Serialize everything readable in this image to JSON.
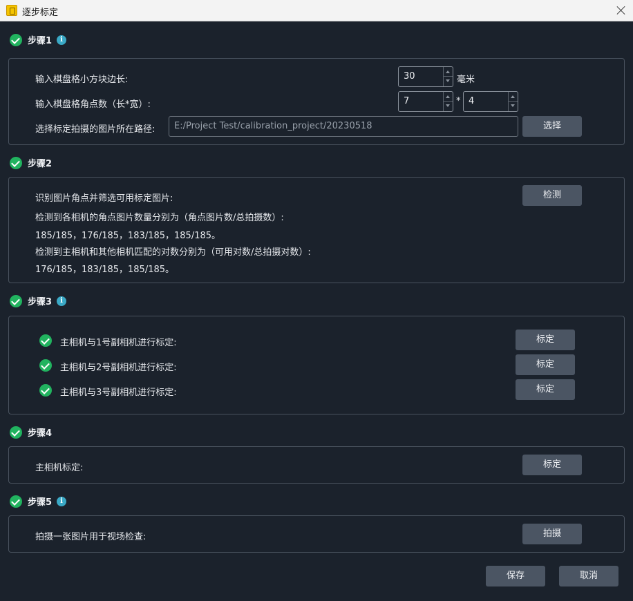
{
  "window": {
    "title": "逐步标定"
  },
  "step1": {
    "title": "步骤1",
    "square_label": "输入棋盘格小方块边长:",
    "square_value": "30",
    "square_unit": "毫米",
    "corners_label": "输入棋盘格角点数（长*宽）:",
    "corners_length": "7",
    "corners_sep": "*",
    "corners_width": "4",
    "path_label": "选择标定拍摄的图片所在路径:",
    "path_value": "E:/Project Test/calibration_project/20230518",
    "choose_button": "选择"
  },
  "step2": {
    "title": "步骤2",
    "detect_label": "识别图片角点并筛选可用标定图片:",
    "detect_button": "检测",
    "line1": "检测到各相机的角点图片数量分别为（角点图片数/总拍摄数）:",
    "line2": "185/185，176/185，183/185，185/185。",
    "line3": "检测到主相机和其他相机匹配的对数分别为（可用对数/总拍摄对数）:",
    "line4": "176/185，183/185，185/185。"
  },
  "step3": {
    "title": "步骤3",
    "items": [
      {
        "label": "主相机与1号副相机进行标定:",
        "button": "标定"
      },
      {
        "label": "主相机与2号副相机进行标定:",
        "button": "标定"
      },
      {
        "label": "主相机与3号副相机进行标定:",
        "button": "标定"
      }
    ]
  },
  "step4": {
    "title": "步骤4",
    "label": "主相机标定:",
    "button": "标定"
  },
  "step5": {
    "title": "步骤5",
    "label": "拍摄一张图片用于视场检查:",
    "button": "拍摄"
  },
  "footer": {
    "save": "保存",
    "cancel": "取消"
  },
  "info_glyph": "i"
}
